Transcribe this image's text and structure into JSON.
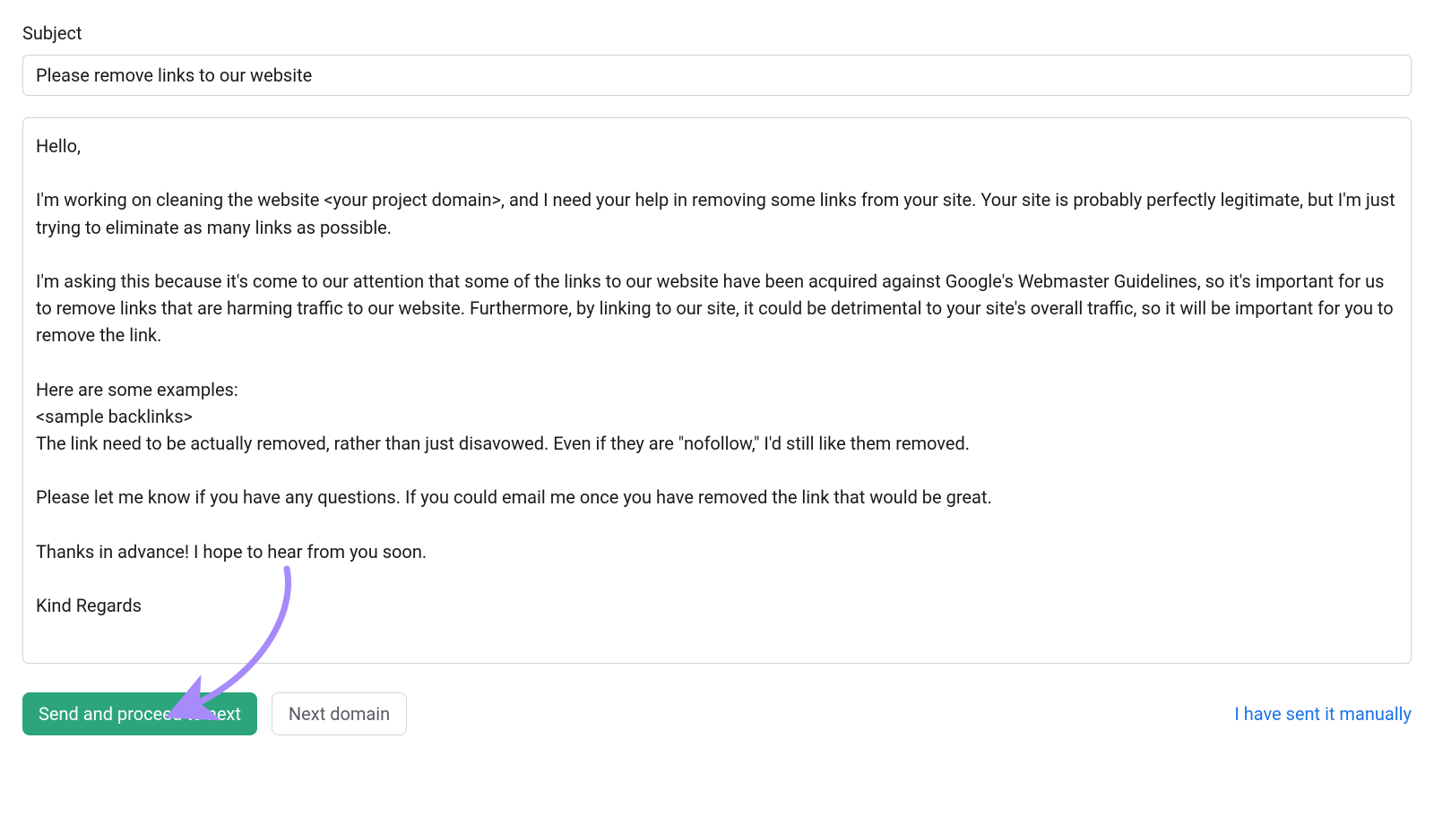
{
  "form": {
    "subject_label": "Subject",
    "subject_value": "Please remove links to our website",
    "message_value": "Hello,\n\nI'm working on cleaning the website <your project domain>, and I need your help in removing some links from your site. Your site is probably perfectly legitimate, but I'm just trying to eliminate as many links as possible.\n\nI'm asking this because it's come to our attention that some of the links to our website have been acquired against Google's Webmaster Guidelines, so it's important for us to remove links that are harming traffic to our website. Furthermore, by linking to our site, it could be detrimental to your site's overall traffic, so it will be important for you to remove the link.\n\nHere are some examples:\n<sample backlinks>\nThe link need to be actually removed, rather than just disavowed. Even if they are \"nofollow,\" I'd still like them removed.\n\nPlease let me know if you have any questions. If you could email me once you have removed the link that would be great.\n\nThanks in advance! I hope to hear from you soon.\n\nKind Regards"
  },
  "actions": {
    "send_label": "Send and proceed to next",
    "next_domain_label": "Next domain",
    "manual_label": "I have sent it manually"
  },
  "annotation": {
    "arrow_color": "#a78bfa"
  }
}
